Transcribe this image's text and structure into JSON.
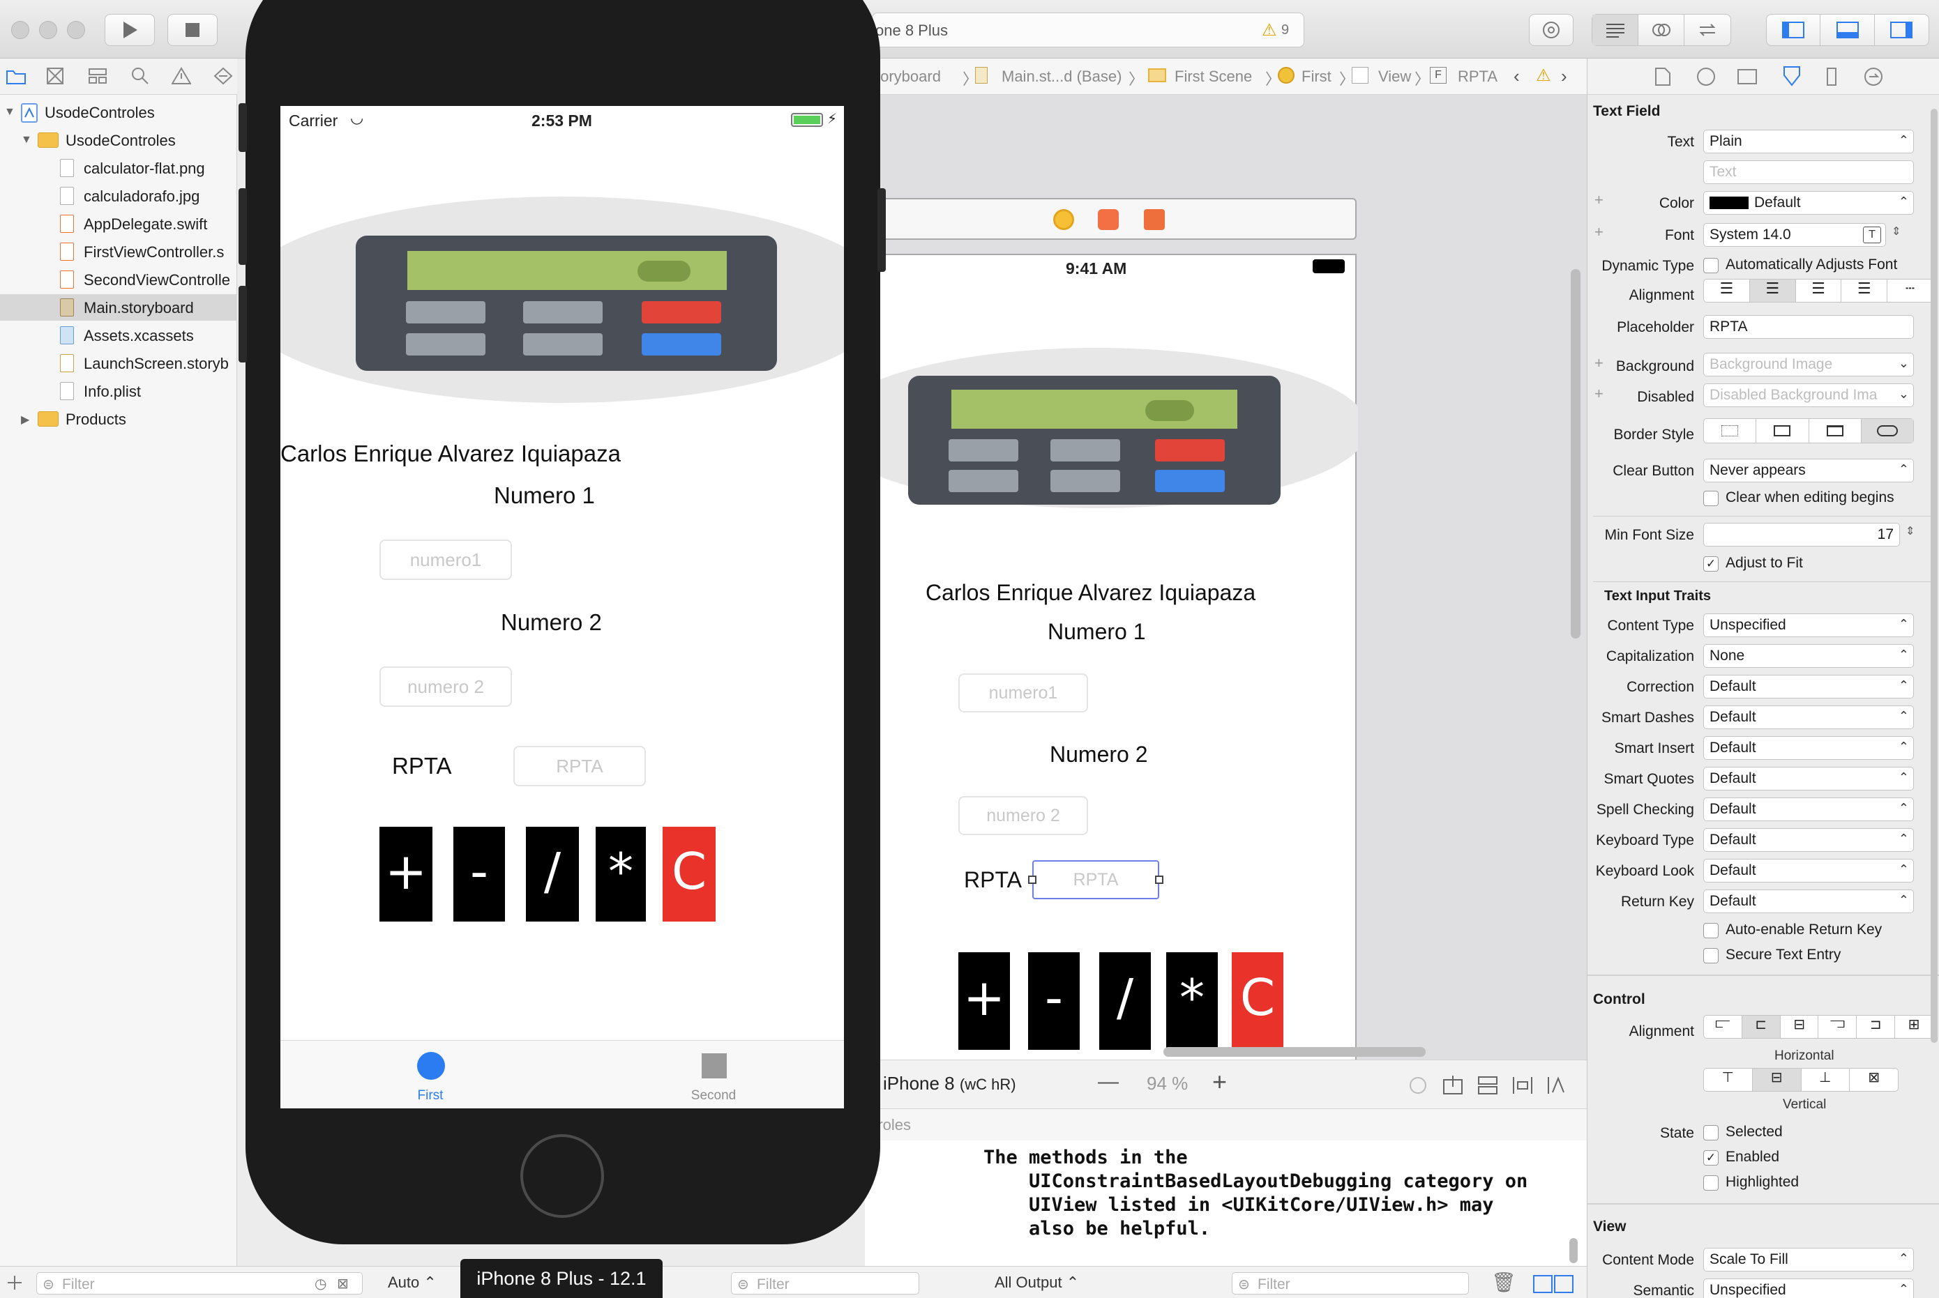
{
  "toolbar": {
    "scheme_device": "one 8 Plus",
    "warning_count": "9"
  },
  "navigator": {
    "project": "UsodeControles",
    "folder": "UsodeControles",
    "files": [
      {
        "name": "calculator-flat.png",
        "kind": "image"
      },
      {
        "name": "calculadorafo.jpg",
        "kind": "image"
      },
      {
        "name": "AppDelegate.swift",
        "kind": "swift"
      },
      {
        "name": "FirstViewController.s",
        "kind": "swift"
      },
      {
        "name": "SecondViewControlle",
        "kind": "swift"
      },
      {
        "name": "Main.storyboard",
        "kind": "storyboard",
        "selected": true
      },
      {
        "name": "Assets.xcassets",
        "kind": "assets"
      },
      {
        "name": "LaunchScreen.storyb",
        "kind": "storyboard"
      },
      {
        "name": "Info.plist",
        "kind": "plist"
      }
    ],
    "products": "Products",
    "filter_placeholder": "Filter"
  },
  "jumpbar": {
    "items": [
      "toryboard",
      "Main.st...d (Base)",
      "First Scene",
      "First",
      "View",
      "RPTA"
    ]
  },
  "canvas": {
    "status_time": "9:41 AM",
    "author_label": "Carlos Enrique Alvarez Iquiapaza",
    "numero1_label": "Numero 1",
    "numero1_placeholder": "numero1",
    "numero2_label": "Numero 2",
    "numero2_placeholder": "numero 2",
    "rpta_label": "RPTA",
    "rpta_placeholder": "RPTA",
    "buttons": [
      "+",
      "-",
      "/",
      "*",
      "C"
    ],
    "device_config": "iPhone 8 (wC hR)",
    "device_name": "iPhone 8",
    "size_class": "(wC hR)",
    "zoom_minus": "—",
    "zoom": "94 %",
    "zoom_plus": "+",
    "debug_target": "ntroles"
  },
  "console": {
    "text": "The methods in the\n    UIConstraintBasedLayoutDebugging category on\n    UIView listed in <UIKitCore/UIView.h> may\n    also be helpful.",
    "output_selector": "All Output ⌃",
    "filter_placeholder": "Filter",
    "auto_label": "Auto ⌃",
    "filter2_placeholder": "Filter"
  },
  "simulator": {
    "carrier": "Carrier",
    "time": "2:53 PM",
    "author_label": "Carlos Enrique Alvarez Iquiapaza",
    "numero1_label": "Numero 1",
    "numero1_placeholder": "numero1",
    "numero2_label": "Numero 2",
    "numero2_placeholder": "numero 2",
    "rpta_label": "RPTA",
    "rpta_placeholder": "RPTA",
    "buttons": [
      "+",
      "-",
      "/",
      "*",
      "C"
    ],
    "tab_first": "First",
    "tab_second": "Second",
    "device_label": "iPhone 8 Plus - 12.1",
    "colors": {
      "accent": "#2a7cf0",
      "clear_button": "#e8322a",
      "battery": "#5ad05a"
    }
  },
  "inspector": {
    "section_textfield": "Text Field",
    "text_label": "Text",
    "text_value": "Plain",
    "text_placeholder": "Text",
    "color_label": "Color",
    "color_value": "Default",
    "font_label": "Font",
    "font_value": "System 14.0",
    "dynamic_type_label": "Dynamic Type",
    "dynamic_type_value": "Automatically Adjusts Font",
    "alignment_label": "Alignment",
    "placeholder_label": "Placeholder",
    "placeholder_value": "RPTA",
    "background_label": "Background",
    "background_value": "Background Image",
    "disabled_label": "Disabled",
    "disabled_value": "Disabled Background Ima",
    "border_style_label": "Border Style",
    "clear_button_label": "Clear Button",
    "clear_button_value": "Never appears",
    "clear_editing": "Clear when editing begins",
    "min_font_label": "Min Font Size",
    "min_font_value": "17",
    "adjust_fit": "Adjust to Fit",
    "section_traits": "Text Input Traits",
    "traits": [
      {
        "label": "Content Type",
        "value": "Unspecified"
      },
      {
        "label": "Capitalization",
        "value": "None"
      },
      {
        "label": "Correction",
        "value": "Default"
      },
      {
        "label": "Smart Dashes",
        "value": "Default"
      },
      {
        "label": "Smart Insert",
        "value": "Default"
      },
      {
        "label": "Smart Quotes",
        "value": "Default"
      },
      {
        "label": "Spell Checking",
        "value": "Default"
      },
      {
        "label": "Keyboard Type",
        "value": "Default"
      },
      {
        "label": "Keyboard Look",
        "value": "Default"
      },
      {
        "label": "Return Key",
        "value": "Default"
      }
    ],
    "auto_enable": "Auto-enable Return Key",
    "secure_entry": "Secure Text Entry",
    "section_control": "Control",
    "control_alignment_label": "Alignment",
    "horizontal": "Horizontal",
    "vertical": "Vertical",
    "state_label": "State",
    "state_selected": "Selected",
    "state_enabled": "Enabled",
    "state_highlighted": "Highlighted",
    "section_view": "View",
    "content_mode_label": "Content Mode",
    "content_mode_value": "Scale To Fill",
    "semantic_label": "Semantic",
    "semantic_value": "Unspecified"
  }
}
